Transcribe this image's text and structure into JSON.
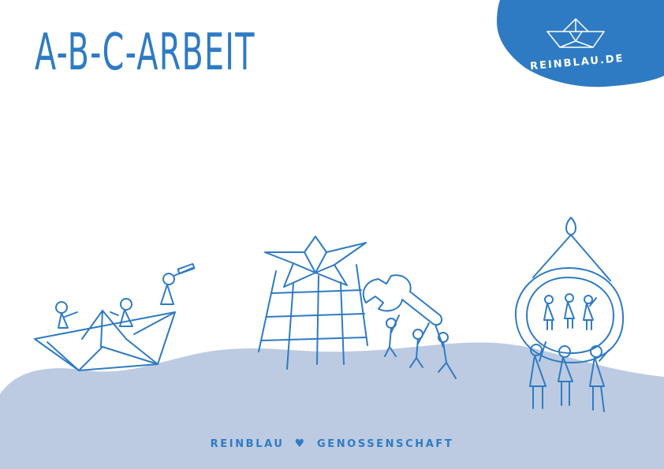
{
  "title": "A-B-C-ARBEIT",
  "logo": {
    "text": "REINBLAU.DE",
    "icon": "paper-boat-icon"
  },
  "footer": {
    "left": "REINBLAU",
    "heart_icon": "♥",
    "right": "GENOSSENSCHAFT"
  },
  "colors": {
    "brand_blue": "#2f7bc3",
    "ground": "#bccbe1",
    "white": "#ffffff"
  },
  "illustrations": [
    "paper-boat-scene",
    "star-tower-scene",
    "wrench-scene",
    "hanging-mirror-scene"
  ]
}
